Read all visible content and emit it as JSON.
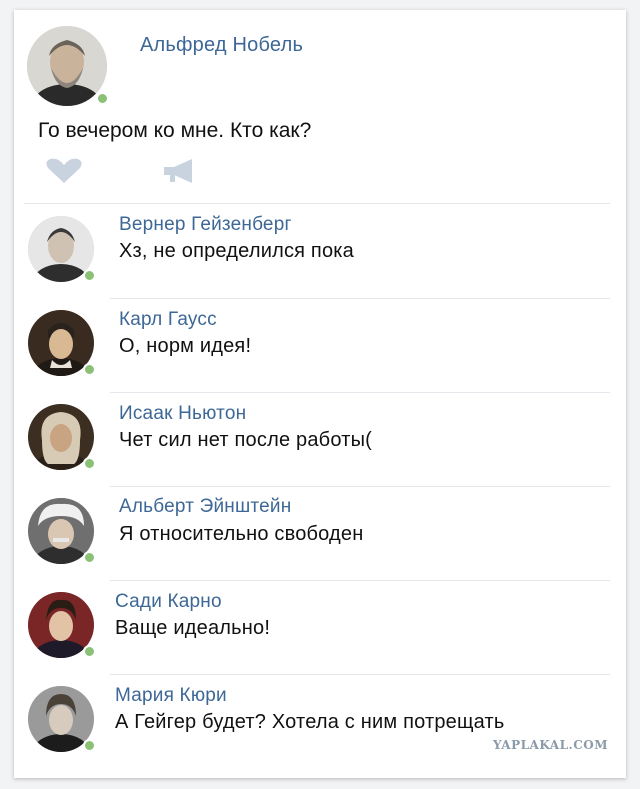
{
  "post": {
    "author": "Альфред Нобель",
    "text": "Го вечером ко мне. Кто как?",
    "like_icon": "heart-icon",
    "share_icon": "megaphone-icon"
  },
  "comments": [
    {
      "name": "Вернер Гейзенберг",
      "text": "Хз, не определился пока"
    },
    {
      "name": "Карл Гаусс",
      "text": "О, норм идея!"
    },
    {
      "name": "Исаак Ньютон",
      "text": "Чет сил нет после работы("
    },
    {
      "name": "Альберт Эйнштейн",
      "text": "Я относительно свободен"
    },
    {
      "name": "Сади Карно",
      "text": "Ваще идеально!"
    },
    {
      "name": "Мария Кюри",
      "text": "А Гейгер будет? Хотела с ним потрещать"
    }
  ],
  "watermark": "YAPLAKAL.COM",
  "colors": {
    "name": "#3d6796",
    "online": "#8ac176",
    "icon": "#c9d3df",
    "divider": "#e3e6ea"
  }
}
